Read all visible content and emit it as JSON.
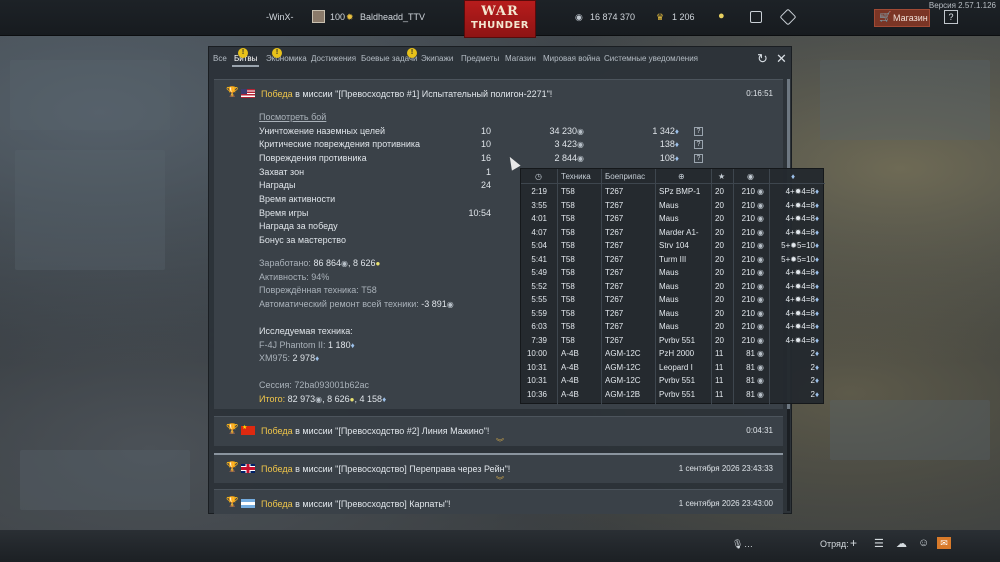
{
  "topbar": {
    "version": "Версия 2.57.1.126",
    "squad_tag": "-WinX-",
    "level": "100",
    "username": "Baldheadd_TTV",
    "logo_line1": "WAR",
    "logo_line2": "THUNDER",
    "silver_lions": "16 874 370",
    "golden_eagles": "1 206",
    "shop_label": "Магазин",
    "help_label": "?"
  },
  "tabs": [
    {
      "label": "Все",
      "warn": false
    },
    {
      "label": "Битвы",
      "warn": true,
      "active": true
    },
    {
      "label": "Экономика",
      "warn": true
    },
    {
      "label": "Достижения",
      "warn": false
    },
    {
      "label": "Боевые задачи",
      "warn": true
    },
    {
      "label": "Экипажи",
      "warn": false
    },
    {
      "label": "Предметы",
      "warn": false
    },
    {
      "label": "Магазин",
      "warn": false
    },
    {
      "label": "Мировая война",
      "warn": false
    },
    {
      "label": "Системные уведомления",
      "warn": false
    }
  ],
  "entries": [
    {
      "victory": "Победа",
      "title": " в миссии \"[Превосходство #1] Испытательный полигон-2271\"!",
      "time": "0:16:51"
    },
    {
      "victory": "Победа",
      "title": " в миссии \"[Превосходство #2] Линия Мажино\"!",
      "time": "0:04:31"
    },
    {
      "victory": "Победа",
      "title": " в миссии \"[Превосходство] Переправа через Рейн\"!",
      "time": "1 сентября 2026 23:43:33"
    },
    {
      "victory": "Победа",
      "title": " в миссии \"[Превосходство] Карпаты\"!",
      "time": "1 сентября 2026 23:43:00"
    }
  ],
  "details": {
    "view_link": "Посмотреть бой",
    "rows": [
      {
        "label": "Уничтожение наземных целей",
        "count": "10",
        "lions": "34 230",
        "rp": "1 342",
        "q": "?"
      },
      {
        "label": "Критические повреждения противника",
        "count": "10",
        "lions": "3 423",
        "rp": "138",
        "q": "?"
      },
      {
        "label": "Повреждения противника",
        "count": "16",
        "lions": "2 844",
        "rp": "108",
        "q": "?"
      },
      {
        "label": "Захват зон",
        "count": "1",
        "lions": "",
        "rp": "",
        "q": ""
      },
      {
        "label": "Награды",
        "count": "24",
        "lions": "",
        "rp": "",
        "q": ""
      },
      {
        "label": "Время активности",
        "count": "",
        "lions": "",
        "rp": "",
        "q": ""
      },
      {
        "label": "Время игры",
        "count": "10:54",
        "lions": "",
        "rp": "",
        "q": ""
      },
      {
        "label": "Награда за победу",
        "count": "",
        "lions": "",
        "rp": "",
        "q": ""
      },
      {
        "label": "Бонус за мастерство",
        "count": "",
        "lions": "",
        "rp": "",
        "q": ""
      }
    ],
    "earned_label": "Заработано:",
    "earned_lions": "86 864",
    "earned_rp": "8 626",
    "activity": "Активность: 94%",
    "damaged_vehicle": "Повреждённая техника: T58",
    "auto_repair_label": "Автоматический ремонт всей техники:",
    "auto_repair_value": "-3 891",
    "research_label": "Исследуемая техника:",
    "research_1_name": "F-4J Phantom II:",
    "research_1_value": "1 180",
    "research_2_name": "XM975:",
    "research_2_value": "2 978",
    "session": "Сессия: 72ba093001b62ac",
    "total_label": "Итого:",
    "total_lions": "82 973",
    "total_rp": "8 626",
    "total_rp2": "4 158"
  },
  "table": {
    "headers": [
      "Техника",
      "Боеприпас"
    ],
    "rows": [
      [
        "2:19",
        "T58",
        "T267",
        "SPz BMP-1",
        "20",
        "210",
        "4",
        "4",
        "8"
      ],
      [
        "3:55",
        "T58",
        "T267",
        "Maus",
        "20",
        "210",
        "4",
        "4",
        "8"
      ],
      [
        "4:01",
        "T58",
        "T267",
        "Maus",
        "20",
        "210",
        "4",
        "4",
        "8"
      ],
      [
        "4:07",
        "T58",
        "T267",
        "Marder A1-",
        "20",
        "210",
        "4",
        "4",
        "8"
      ],
      [
        "5:04",
        "T58",
        "T267",
        "Strv 104",
        "20",
        "210",
        "5",
        "5",
        "10"
      ],
      [
        "5:41",
        "T58",
        "T267",
        "Turm III",
        "20",
        "210",
        "5",
        "5",
        "10"
      ],
      [
        "5:49",
        "T58",
        "T267",
        "Maus",
        "20",
        "210",
        "4",
        "4",
        "8"
      ],
      [
        "5:52",
        "T58",
        "T267",
        "Maus",
        "20",
        "210",
        "4",
        "4",
        "8"
      ],
      [
        "5:55",
        "T58",
        "T267",
        "Maus",
        "20",
        "210",
        "4",
        "4",
        "8"
      ],
      [
        "5:59",
        "T58",
        "T267",
        "Maus",
        "20",
        "210",
        "4",
        "4",
        "8"
      ],
      [
        "6:03",
        "T58",
        "T267",
        "Maus",
        "20",
        "210",
        "4",
        "4",
        "8"
      ],
      [
        "7:39",
        "T58",
        "T267",
        "Pvrbv 551",
        "20",
        "210",
        "4",
        "4",
        "8"
      ],
      [
        "10:00",
        "A-4B",
        "AGM-12C",
        "PzH 2000",
        "11",
        "81",
        "",
        "",
        "2"
      ],
      [
        "10:31",
        "A-4B",
        "AGM-12C",
        "Leopard I",
        "11",
        "81",
        "",
        "",
        "2"
      ],
      [
        "10:31",
        "A-4B",
        "AGM-12C",
        "Pvrbv 551",
        "11",
        "81",
        "",
        "",
        "2"
      ],
      [
        "10:36",
        "A-4B",
        "AGM-12B",
        "Pvrbv 551",
        "11",
        "81",
        "",
        "",
        "2"
      ]
    ]
  },
  "bottombar": {
    "voice": "…",
    "squad_label": "Отряд:"
  }
}
